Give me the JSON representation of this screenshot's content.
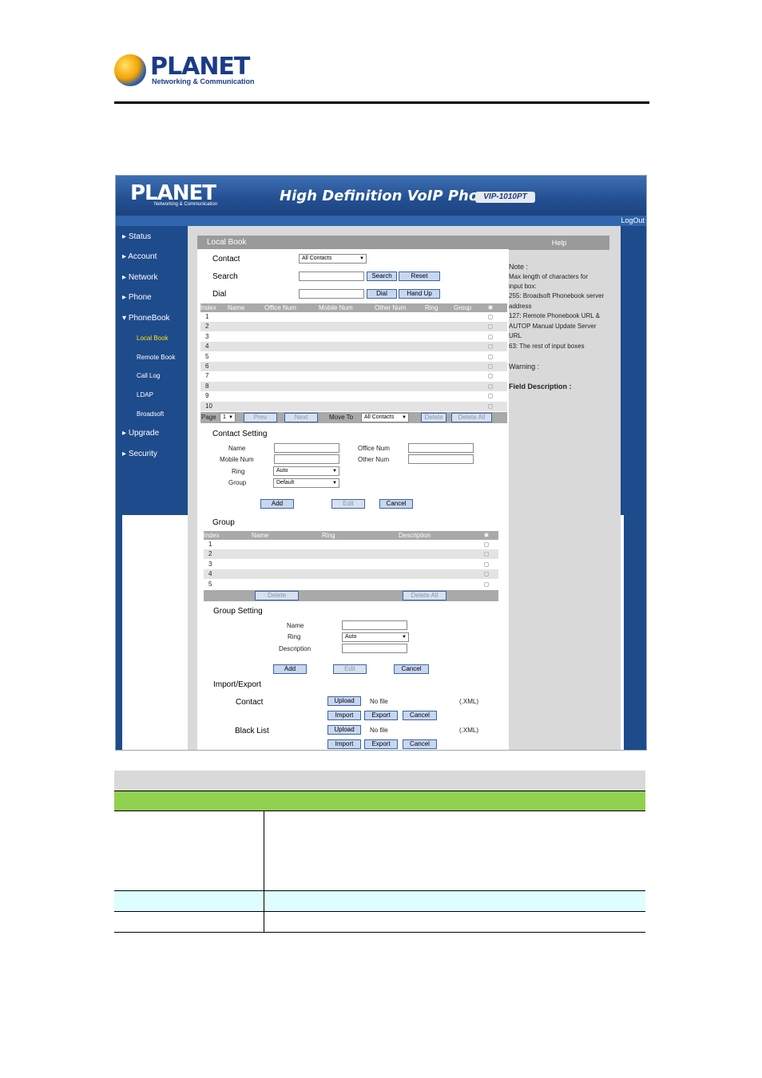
{
  "doc": {
    "logo_brand": "PLANET",
    "logo_tagline": "Networking & Communication"
  },
  "banner": {
    "brand": "PLANET",
    "brand_sub": "Networking & Communication",
    "product": "High Definition VoIP Phone",
    "model": "VIP-1010PT",
    "logout": "LogOut"
  },
  "sidebar": {
    "items": [
      "Status",
      "Account",
      "Network",
      "Phone",
      "PhoneBook"
    ],
    "phonebook_sub": [
      "Local Book",
      "Remote Book",
      "Call Log",
      "LDAP",
      "Broadsoft"
    ],
    "items_after": [
      "Upgrade",
      "Security"
    ]
  },
  "local_book": {
    "title": "Local Book",
    "contact_label": "Contact",
    "contact_select": "All Contacts",
    "search_label": "Search",
    "search_btn": "Search",
    "reset_btn": "Reset",
    "dial_label": "Dial",
    "dial_btn": "Dial",
    "handup_btn": "Hand Up",
    "columns": [
      "Index",
      "Name",
      "Office Num",
      "Mobile Num",
      "Other Num",
      "Ring",
      "Group"
    ],
    "rows": [
      "1",
      "2",
      "3",
      "4",
      "5",
      "6",
      "7",
      "8",
      "9",
      "10"
    ],
    "page_label": "Page",
    "page_value": "1",
    "prev_btn": "Prev",
    "next_btn": "Next",
    "move_to_label": "Move To",
    "move_to_select": "All Contacts",
    "delete_btn": "Delete",
    "delete_all_btn": "Delete All"
  },
  "contact_setting": {
    "title": "Contact Setting",
    "name_label": "Name",
    "office_label": "Office Num",
    "mobile_label": "Mobile Num",
    "other_label": "Other Num",
    "ring_label": "Ring",
    "ring_value": "Auto",
    "group_label": "Group",
    "group_value": "Default",
    "add_btn": "Add",
    "edit_btn": "Edit",
    "cancel_btn": "Cancel"
  },
  "group": {
    "title": "Group",
    "columns": [
      "Index",
      "Name",
      "Ring",
      "Description"
    ],
    "rows": [
      "1",
      "2",
      "3",
      "4",
      "5"
    ],
    "delete_btn": "Delete",
    "delete_all_btn": "Delete All"
  },
  "group_setting": {
    "title": "Group Setting",
    "name_label": "Name",
    "ring_label": "Ring",
    "ring_value": "Auto",
    "desc_label": "Description",
    "add_btn": "Add",
    "edit_btn": "Edit",
    "cancel_btn": "Cancel"
  },
  "import_export": {
    "title": "Import/Export",
    "contact_label": "Contact",
    "blacklist_label": "Black List",
    "upload_btn": "Upload",
    "no_file": "No file",
    "xml": "(.XML)",
    "import_btn": "Import",
    "export_btn": "Export",
    "cancel_btn": "Cancel"
  },
  "help": {
    "title": "Help",
    "lines": [
      "Note :",
      "Max length of characters for",
      "input box:",
      "255: Broadsoft Phonebook server",
      "address",
      "127: Remote Phonebook URL &",
      "AUTOP Manual Update Server",
      "URL",
      "63: The rest of input boxes"
    ],
    "warning": "Warning :",
    "field_desc": "Field Description :"
  }
}
